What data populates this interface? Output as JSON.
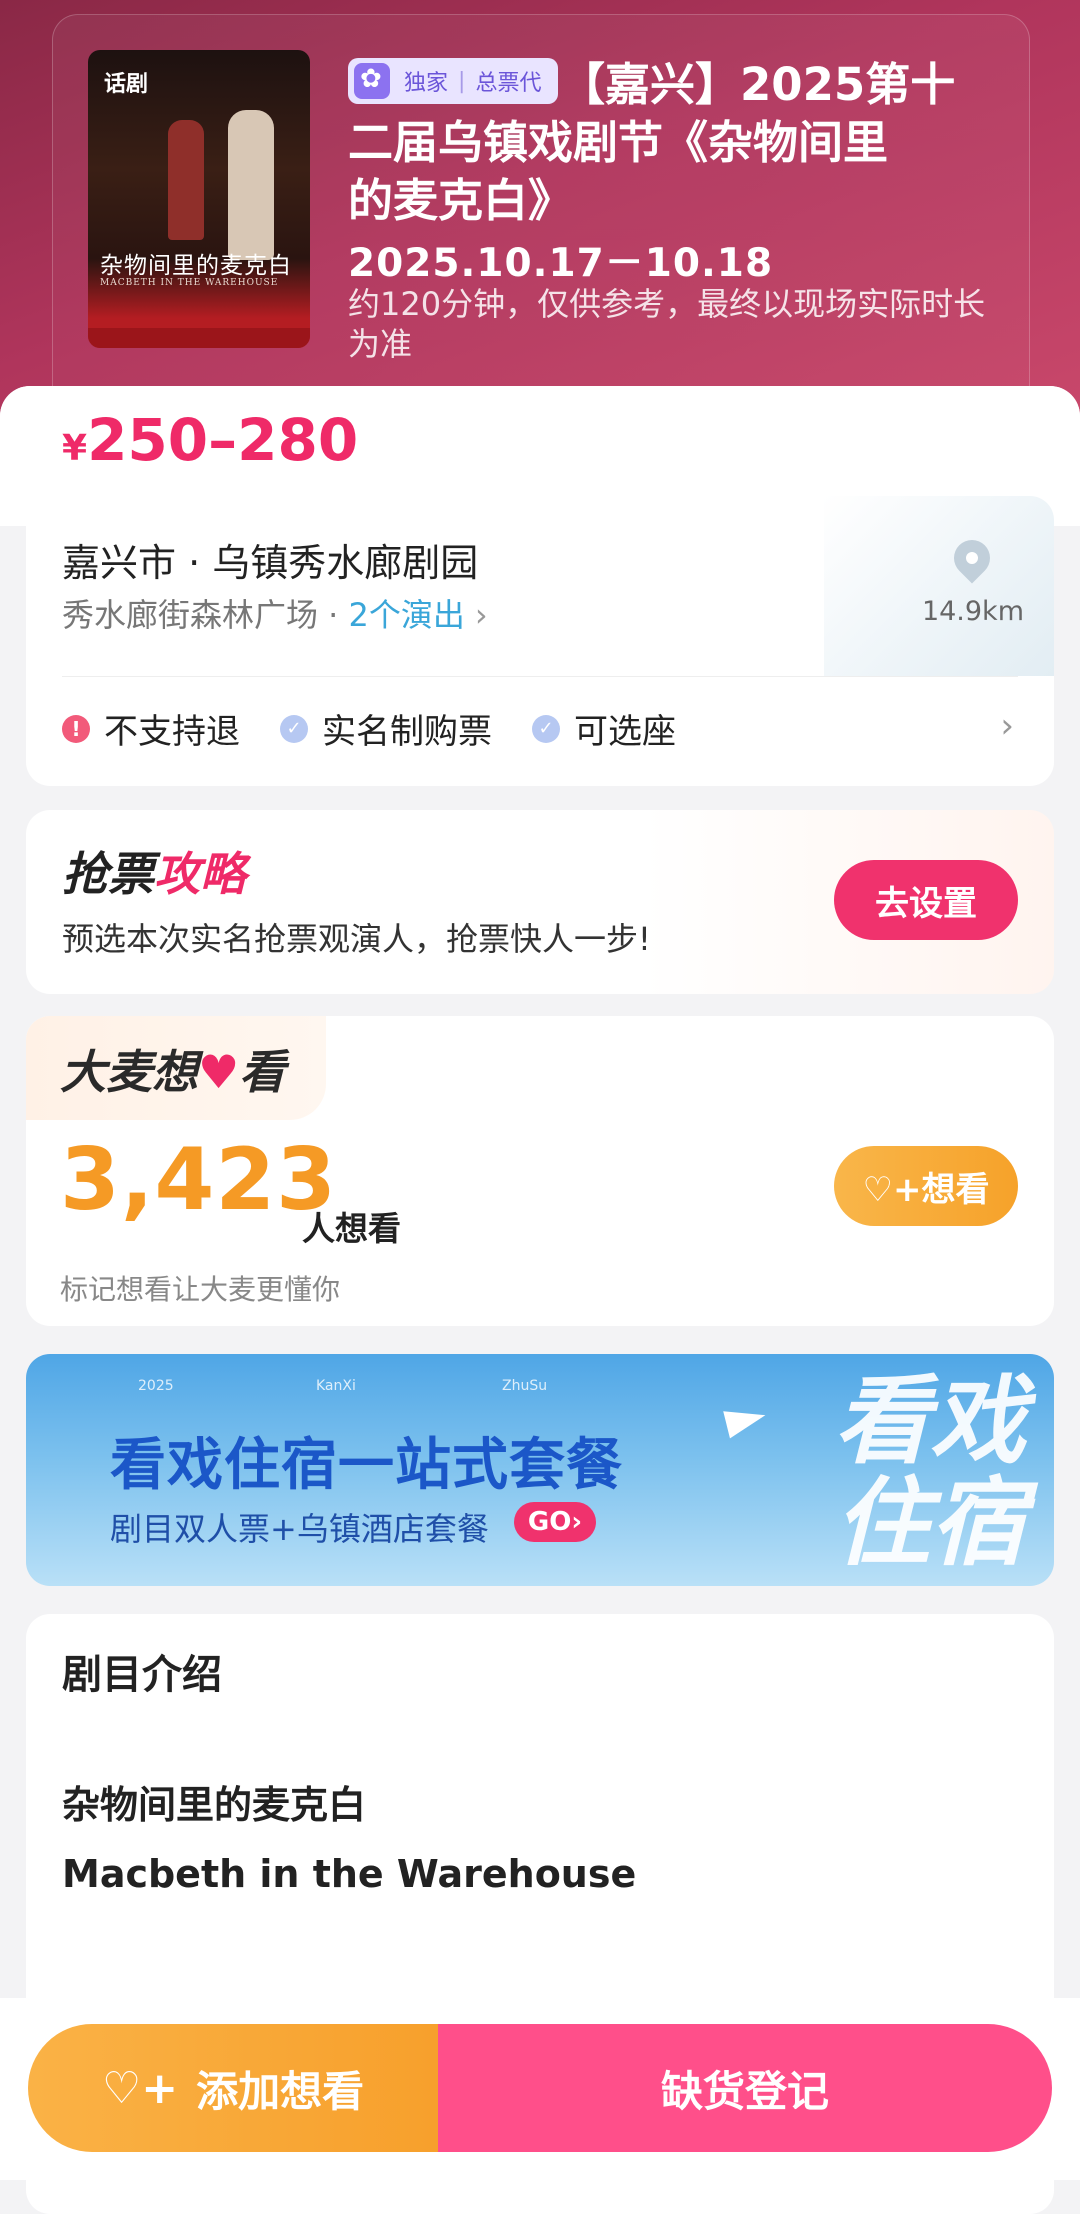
{
  "hero": {
    "poster_tag": "话剧",
    "poster_title": "杂物间里的麦克白",
    "poster_subtitle": "MACBETH IN THE WAREHOUSE",
    "badge_left": "独家",
    "badge_right": "总票代",
    "title_line1": "【嘉兴】2025第十",
    "title_line2": "二届乌镇戏剧节《杂物间里",
    "title_line3": "的麦克白》",
    "date": "2025.10.17－10.18",
    "duration": "约120分钟，仅供参考，最终以现场实际时长为准"
  },
  "price": {
    "currency": "¥",
    "range": "250–280"
  },
  "venue": {
    "name": "嘉兴市 · 乌镇秀水廊剧园",
    "address": "秀水廊街森林广场 · ",
    "shows_link": "2个演出",
    "distance": "14.9km",
    "features": [
      "不支持退",
      "实名制购票",
      "可选座"
    ]
  },
  "strategy": {
    "title_a": "抢票",
    "title_b": "攻略",
    "subtitle": "预选本次实名抢票观演人，抢票快人一步!",
    "button": "去设置"
  },
  "want": {
    "title_a": "大麦想",
    "title_heart": "♥",
    "title_b": "看",
    "count": "3,423",
    "unit": "人想看",
    "subtitle": "标记想看让大麦更懂你",
    "button": "♡+想看"
  },
  "banner": {
    "tiny1": "2025",
    "tiny2": "KanXi",
    "tiny3": "ZhuSu",
    "title": "看戏住宿一站式套餐",
    "subtitle": "剧目双人票+乌镇酒店套餐",
    "go": "GO›",
    "big_line1": "看戏",
    "big_line2": "住宿"
  },
  "intro": {
    "heading": "剧目介绍",
    "title_cn": "杂物间里的麦克白",
    "title_en": "Macbeth in the Warehouse"
  },
  "bottom_bar": {
    "left": "添加想看",
    "left_icon": "♡+",
    "right": "缺货登记"
  },
  "colors": {
    "accent_pink": "#ef2a68",
    "accent_orange": "#f59a25",
    "link_blue": "#3aa6d9"
  }
}
